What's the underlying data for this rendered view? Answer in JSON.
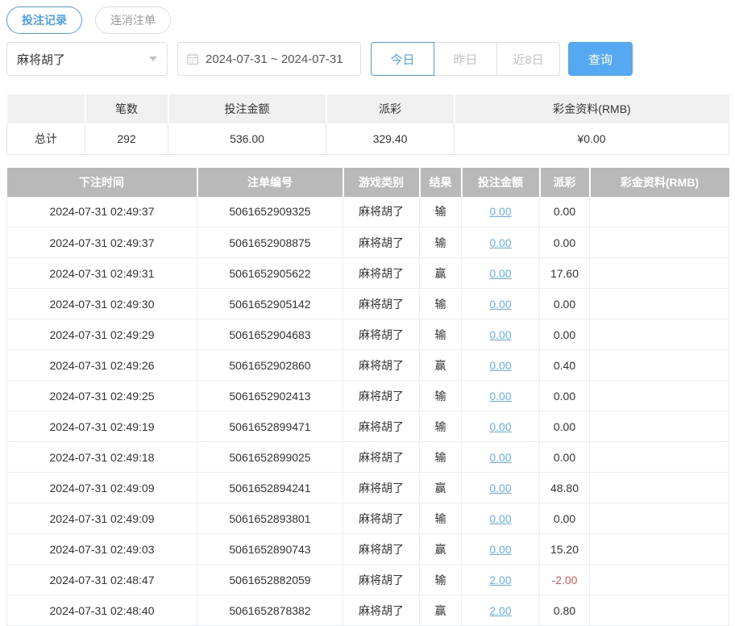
{
  "colors": {
    "accent": "#4aa0f2",
    "search_button": "#55a9f1",
    "link": "#64b0f2",
    "negative": "#e45656",
    "table_header_bg": "#b9b9b9"
  },
  "tabs": [
    {
      "label": "投注记录",
      "active": true
    },
    {
      "label": "连消注单",
      "active": false
    }
  ],
  "filters": {
    "game_select": {
      "value": "麻将胡了"
    },
    "date_range": {
      "value": "2024-07-31 ~ 2024-07-31"
    },
    "quick_buttons": [
      {
        "label": "今日",
        "active": true
      },
      {
        "label": "昨日",
        "active": false
      },
      {
        "label": "近8日",
        "active": false
      }
    ],
    "search_label": "查询"
  },
  "summary": {
    "headers": [
      "",
      "笔数",
      "投注金额",
      "派彩",
      "彩金资料(RMB)"
    ],
    "row": {
      "label": "总计",
      "count": "292",
      "bet_amount": "536.00",
      "payout": "329.40",
      "bonus": "¥0.00"
    }
  },
  "table": {
    "headers": [
      "下注时间",
      "注单编号",
      "游戏类别",
      "结果",
      "投注金额",
      "派彩",
      "彩金资料(RMB)"
    ],
    "rows": [
      {
        "time": "2024-07-31 02:49:37",
        "bet_id": "5061652909325",
        "game": "麻将胡了",
        "result": "输",
        "bet_amount": "0.00",
        "payout": "0.00",
        "bonus": ""
      },
      {
        "time": "2024-07-31 02:49:37",
        "bet_id": "5061652908875",
        "game": "麻将胡了",
        "result": "输",
        "bet_amount": "0.00",
        "payout": "0.00",
        "bonus": ""
      },
      {
        "time": "2024-07-31 02:49:31",
        "bet_id": "5061652905622",
        "game": "麻将胡了",
        "result": "赢",
        "bet_amount": "0.00",
        "payout": "17.60",
        "bonus": ""
      },
      {
        "time": "2024-07-31 02:49:30",
        "bet_id": "5061652905142",
        "game": "麻将胡了",
        "result": "输",
        "bet_amount": "0.00",
        "payout": "0.00",
        "bonus": ""
      },
      {
        "time": "2024-07-31 02:49:29",
        "bet_id": "5061652904683",
        "game": "麻将胡了",
        "result": "输",
        "bet_amount": "0.00",
        "payout": "0.00",
        "bonus": ""
      },
      {
        "time": "2024-07-31 02:49:26",
        "bet_id": "5061652902860",
        "game": "麻将胡了",
        "result": "赢",
        "bet_amount": "0.00",
        "payout": "0.40",
        "bonus": ""
      },
      {
        "time": "2024-07-31 02:49:25",
        "bet_id": "5061652902413",
        "game": "麻将胡了",
        "result": "输",
        "bet_amount": "0.00",
        "payout": "0.00",
        "bonus": ""
      },
      {
        "time": "2024-07-31 02:49:19",
        "bet_id": "5061652899471",
        "game": "麻将胡了",
        "result": "输",
        "bet_amount": "0.00",
        "payout": "0.00",
        "bonus": ""
      },
      {
        "time": "2024-07-31 02:49:18",
        "bet_id": "5061652899025",
        "game": "麻将胡了",
        "result": "输",
        "bet_amount": "0.00",
        "payout": "0.00",
        "bonus": ""
      },
      {
        "time": "2024-07-31 02:49:09",
        "bet_id": "5061652894241",
        "game": "麻将胡了",
        "result": "赢",
        "bet_amount": "0.00",
        "payout": "48.80",
        "bonus": ""
      },
      {
        "time": "2024-07-31 02:49:09",
        "bet_id": "5061652893801",
        "game": "麻将胡了",
        "result": "输",
        "bet_amount": "0.00",
        "payout": "0.00",
        "bonus": ""
      },
      {
        "time": "2024-07-31 02:49:03",
        "bet_id": "5061652890743",
        "game": "麻将胡了",
        "result": "赢",
        "bet_amount": "0.00",
        "payout": "15.20",
        "bonus": ""
      },
      {
        "time": "2024-07-31 02:48:47",
        "bet_id": "5061652882059",
        "game": "麻将胡了",
        "result": "输",
        "bet_amount": "2.00",
        "payout": "-2.00",
        "bonus": ""
      },
      {
        "time": "2024-07-31 02:48:40",
        "bet_id": "5061652878382",
        "game": "麻将胡了",
        "result": "赢",
        "bet_amount": "2.00",
        "payout": "0.80",
        "bonus": ""
      }
    ]
  }
}
